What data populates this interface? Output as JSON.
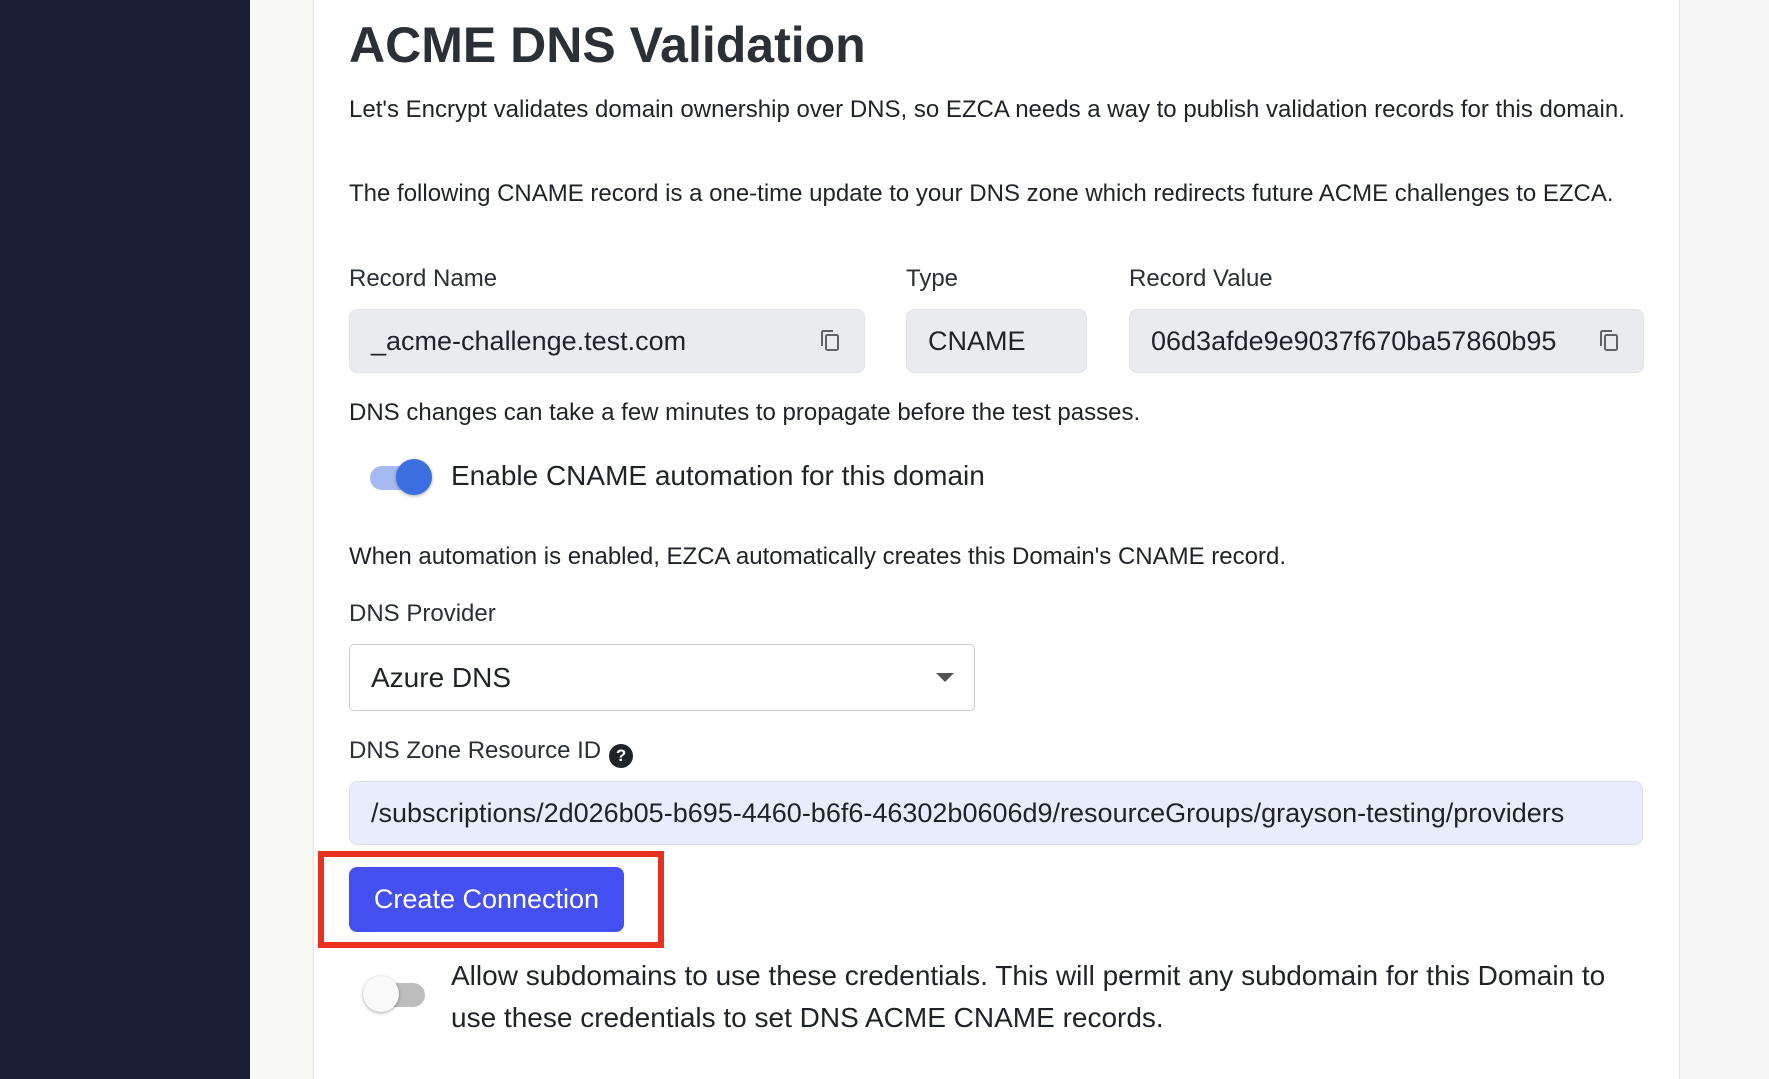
{
  "section": {
    "title": "ACME DNS Validation",
    "intro": "Let's Encrypt validates domain ownership over DNS, so EZCA needs a way to publish validation records for this domain.",
    "cname_info": "The following CNAME record is a one-time update to your DNS zone which redirects future ACME challenges to EZCA."
  },
  "record": {
    "name_label": "Record Name",
    "name_value": "_acme-challenge.test.com",
    "type_label": "Type",
    "type_value": "CNAME",
    "value_label": "Record Value",
    "value_value": "06d3afde9e9037f670ba57860b95"
  },
  "propagation_note": "DNS changes can take a few minutes to propagate before the test passes.",
  "automation": {
    "toggle_label": "Enable CNAME automation for this domain",
    "enabled": true,
    "note": "When automation is enabled, EZCA automatically creates this Domain's CNAME record."
  },
  "provider": {
    "label": "DNS Provider",
    "selected": "Azure DNS"
  },
  "zone": {
    "label": "DNS Zone Resource ID",
    "help_glyph": "?",
    "value": "/subscriptions/2d026b05-b695-4460-b6f6-46302b0606d9/resourceGroups/grayson-testing/providers"
  },
  "actions": {
    "create_label": "Create Connection"
  },
  "subdomains": {
    "toggle_label": "Allow subdomains to use these credentials. This will permit any subdomain for this Domain to use these credentials to set DNS ACME CNAME records.",
    "enabled": false
  },
  "colors": {
    "sidebar": "#1a1f36",
    "primary_button": "#4450f2",
    "toggle_on": "#3b6fe0",
    "highlight": "#e8321f"
  },
  "icons": {
    "copy": "copy-icon",
    "help": "help-icon",
    "dropdown": "chevron-down-icon"
  }
}
